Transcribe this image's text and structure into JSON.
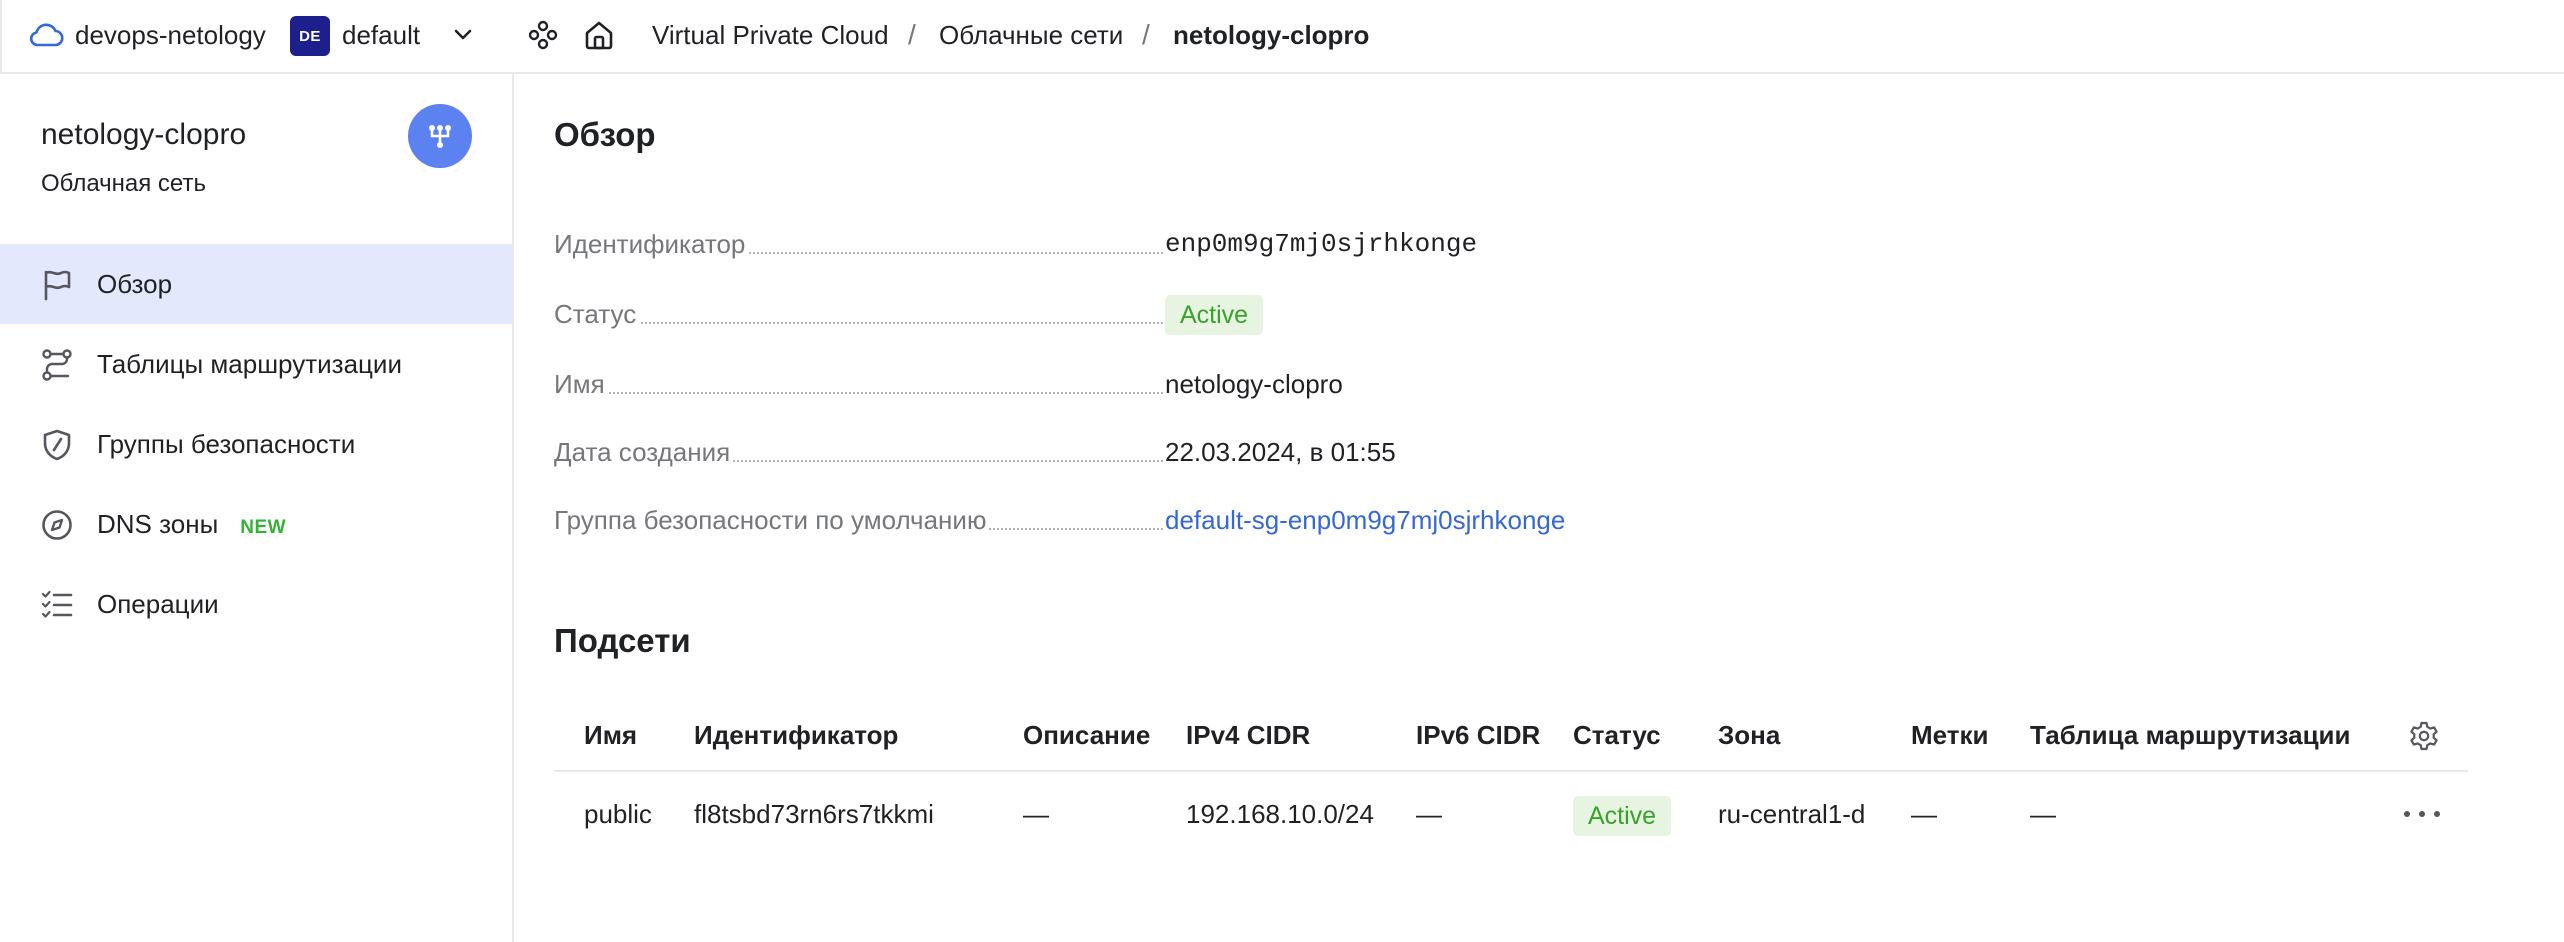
{
  "topbar": {
    "cloud_label": "devops-netology",
    "folder_badge": "DE",
    "folder_label": "default",
    "breadcrumbs": [
      {
        "label": "Virtual Private Cloud"
      },
      {
        "label": "Облачные сети"
      },
      {
        "label": "netology-clopro"
      }
    ],
    "separator": "/"
  },
  "sidebar": {
    "title": "netology-clopro",
    "subtitle": "Облачная сеть",
    "items": [
      {
        "label": "Обзор",
        "icon": "flag-icon",
        "active": true
      },
      {
        "label": "Таблицы маршрутизации",
        "icon": "route-icon"
      },
      {
        "label": "Группы безопасности",
        "icon": "shield-icon"
      },
      {
        "label": "DNS зоны",
        "icon": "compass-icon",
        "badge": "NEW"
      },
      {
        "label": "Операции",
        "icon": "list-check-icon"
      }
    ]
  },
  "overview": {
    "heading": "Обзор",
    "properties": [
      {
        "label": "Идентификатор",
        "value": "enp0m9g7mj0sjrhkonge"
      },
      {
        "label": "Статус",
        "value": "Active"
      },
      {
        "label": "Имя",
        "value": "netology-clopro"
      },
      {
        "label": "Дата создания",
        "value": "22.03.2024, в 01:55"
      },
      {
        "label": "Группа безопасности по умолчанию",
        "value": "default-sg-enp0m9g7mj0sjrhkonge"
      }
    ]
  },
  "subnets": {
    "heading": "Подсети",
    "columns": [
      "Имя",
      "Идентификатор",
      "Описание",
      "IPv4 CIDR",
      "IPv6 CIDR",
      "Статус",
      "Зона",
      "Метки",
      "Таблица маршрутизации"
    ],
    "rows": [
      {
        "name": "public",
        "id": "fl8tsbd73rn6rs7tkkmi",
        "description": "—",
        "ipv4": "192.168.10.0/24",
        "ipv6": "—",
        "status": "Active",
        "zone": "ru-central1-d",
        "labels": "—",
        "route_table": "—"
      }
    ]
  },
  "colors": {
    "accent": "#5b82f0",
    "link": "#3667d6",
    "active_nav_bg": "#e3e8fc",
    "status_bg": "#e6f4e1",
    "status_text": "#3aa22b",
    "badge_new": "#34b233",
    "folder_badge_bg": "#1d1f8c"
  }
}
